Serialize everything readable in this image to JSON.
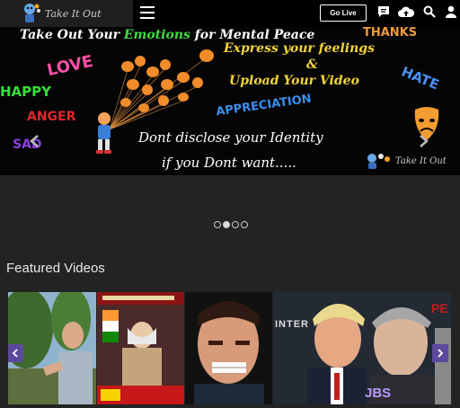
{
  "header": {
    "logo_text": "Take It Out",
    "golive_label": "Go Live",
    "icons": [
      "menu-icon",
      "chat-icon",
      "cloud-upload-icon",
      "search-icon",
      "user-icon"
    ]
  },
  "banner": {
    "headline_1": "Take Out Your",
    "headline_emotions": "Emotions",
    "headline_2": "for Mental Peace",
    "thanks": "THANKS",
    "express": "Express your feelings",
    "amp": "&",
    "upload": "Upload Your Video",
    "love": "LOVE",
    "hate": "HATE",
    "happy": "HAPPY",
    "anger": "ANGER",
    "sad": "SAD",
    "appreciation": "APPRECIATION",
    "disclose_1": "Dont disclose your Identity",
    "disclose_2": "if you Dont want.....",
    "small_logo_text": "Take It Out"
  },
  "carousel": {
    "dot_count": 4,
    "active_index": 1
  },
  "featured": {
    "title": "Featured Videos",
    "overlay_texts": {
      "jbs": "JBS",
      "inter": "INTER",
      "pe": "PE"
    }
  },
  "colors": {
    "navbar": "#000000",
    "page_bg": "#232323",
    "slider_button": "#5b4a9c",
    "emotions_green": "#3fdc3f",
    "express_yellow": "#f2d43a",
    "love_pink": "#ff4fa8",
    "happy_green": "#33e03a",
    "anger_red": "#e0262a",
    "sad_purple": "#8a3fe0",
    "appreciation_blue": "#3c8ef0",
    "hate_blue": "#4a8ff0",
    "thanks_orange": "#f09a3c"
  }
}
